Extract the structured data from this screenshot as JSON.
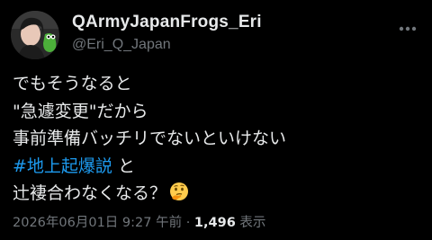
{
  "author": {
    "display_name": "QArmyJapanFrogs_Eri",
    "handle": "@Eri_Q_Japan"
  },
  "tweet": {
    "line1": "でもそうなると",
    "line2": "\"急遽変更\"だから",
    "line3": "事前準備バッチリでないといけない",
    "hashtag": "#地上起爆説",
    "line4_suffix": " と",
    "line5": "辻褄合わなくなる？",
    "emoji": "thinking-face-emoji"
  },
  "meta": {
    "timestamp": "2026年06月01日 9:27 午前",
    "separator": " · ",
    "views_count": "1,496",
    "views_label": " 表示"
  },
  "icons": {
    "more": "more-options-icon"
  },
  "colors": {
    "background": "#000000",
    "text": "#e7e9ea",
    "secondary": "#71767b",
    "link": "#1d9bf0"
  }
}
